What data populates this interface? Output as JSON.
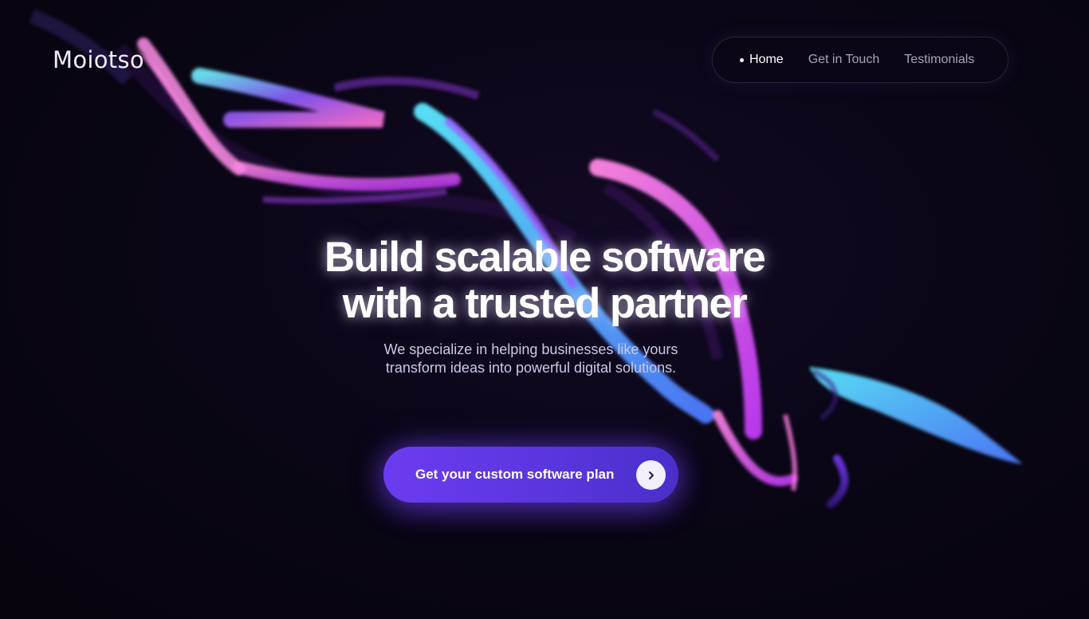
{
  "brand": {
    "name": "Moiotso"
  },
  "nav": {
    "items": [
      {
        "label": "Home",
        "active": true
      },
      {
        "label": "Get in Touch",
        "active": false
      },
      {
        "label": "Testimonials",
        "active": false
      }
    ]
  },
  "hero": {
    "title_line1": "Build scalable software",
    "title_line2": "with a trusted partner",
    "subtitle": "We specialize in helping businesses like yours transform ideas into powerful digital solutions.",
    "cta_label": "Get your custom software plan",
    "cta_icon": "chevron-right-icon"
  },
  "colors": {
    "background": "#08040f",
    "accent_purple": "#6c3cf0",
    "ribbon_pink": "#ff6fd8",
    "ribbon_cyan": "#6ff2ff",
    "ribbon_violet": "#8a4dff"
  }
}
